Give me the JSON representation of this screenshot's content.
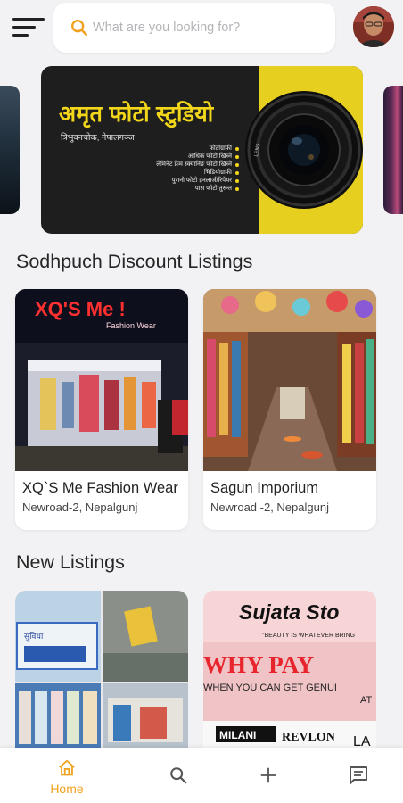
{
  "header": {
    "search_placeholder": "What are you looking for?"
  },
  "banner": {
    "title": "अमृत फोटो स्टुडियो",
    "subtitle": "त्रिभुवनचोक, नेपालगञ्ज",
    "services": [
      "फोटोग्राफी",
      "आधिक फोटो खिच्ने",
      "लेमिनेट फ्रेम स्क्यानिङ फोटो खिच्ने",
      "भिडियोग्राफी",
      "पुरानो फोटो इनलार्ज/रिपेयर",
      "पास फोटो तुरुन्त"
    ],
    "lens_text": "LEN5"
  },
  "sections": {
    "discount_title": "Sodhpuch Discount Listings",
    "new_title": "New Listings"
  },
  "discount_listings": [
    {
      "name": "XQ`S Me Fashion Wear",
      "address": "Newroad-2, Nepalgunj",
      "sign_text": "XQ'S Me !",
      "sign_sub": "Fashion Wear"
    },
    {
      "name": "Sagun Imporium",
      "address": "Newroad -2, Nepalgunj"
    }
  ],
  "new_listings": [
    {
      "sign_text": "सुविधा"
    },
    {
      "title": "Sujata Sto",
      "tagline": "\"BEAUTY IS WHATEVER BRING",
      "headline": "WHY PAY",
      "sub": "WHEN YOU CAN GET GENUI",
      "sub2": "AT",
      "brands": [
        "MILANI",
        "REVLON",
        "LA"
      ]
    }
  ],
  "bottom_nav": {
    "home_label": "Home"
  },
  "colors": {
    "accent": "#f0a21f",
    "background": "#f2f2f4",
    "banner_yellow": "#e7cf1f"
  },
  "icons": [
    "menu-icon",
    "search-icon",
    "home-icon",
    "plus-icon",
    "chat-icon"
  ]
}
